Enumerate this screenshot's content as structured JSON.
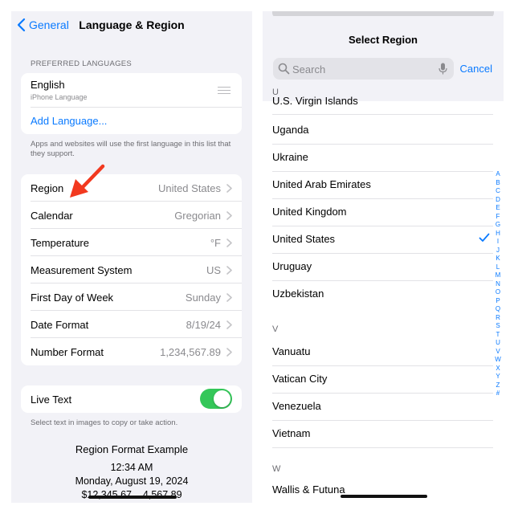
{
  "left": {
    "back_label": "General",
    "title": "Language & Region",
    "preferred_header": "PREFERRED LANGUAGES",
    "language": {
      "name": "English",
      "sub": "iPhone Language"
    },
    "add_language": "Add Language...",
    "footnote": "Apps and websites will use the first language in this list that they support.",
    "rows": [
      {
        "label": "Region",
        "value": "United States"
      },
      {
        "label": "Calendar",
        "value": "Gregorian"
      },
      {
        "label": "Temperature",
        "value": "°F"
      },
      {
        "label": "Measurement System",
        "value": "US"
      },
      {
        "label": "First Day of Week",
        "value": "Sunday"
      },
      {
        "label": "Date Format",
        "value": "8/19/24"
      },
      {
        "label": "Number Format",
        "value": "1,234,567.89"
      }
    ],
    "live_text": {
      "label": "Live Text",
      "on": true
    },
    "live_text_footnote": "Select text in images to copy or take action.",
    "example": {
      "title": "Region Format Example",
      "time": "12:34 AM",
      "date": "Monday, August 19, 2024",
      "money": "$12,345.67    4,567.89"
    }
  },
  "right": {
    "title": "Select Region",
    "search_placeholder": "Search",
    "cancel_label": "Cancel",
    "sections": [
      {
        "letter": "U",
        "items": [
          "U.S. Virgin Islands",
          "Uganda",
          "Ukraine",
          "United Arab Emirates",
          "United Kingdom",
          "United States",
          "Uruguay",
          "Uzbekistan"
        ]
      },
      {
        "letter": "V",
        "items": [
          "Vanuatu",
          "Vatican City",
          "Venezuela",
          "Vietnam"
        ]
      },
      {
        "letter": "W",
        "items": [
          "Wallis & Futuna"
        ]
      }
    ],
    "selected": "United States",
    "index_letters": [
      "A",
      "B",
      "C",
      "D",
      "E",
      "F",
      "G",
      "H",
      "I",
      "J",
      "K",
      "L",
      "M",
      "N",
      "O",
      "P",
      "Q",
      "R",
      "S",
      "T",
      "U",
      "V",
      "W",
      "X",
      "Y",
      "Z",
      "#"
    ]
  },
  "colors": {
    "accent": "#0a7aff",
    "toggle_on": "#34c759",
    "arrow": "#f2391f",
    "group_bg": "#f2f2f7"
  },
  "icons": [
    "chevron-left-icon",
    "drag-handle-icon",
    "chevron-right-icon",
    "red-arrow-icon",
    "search-icon",
    "mic-icon",
    "checkmark-icon"
  ]
}
